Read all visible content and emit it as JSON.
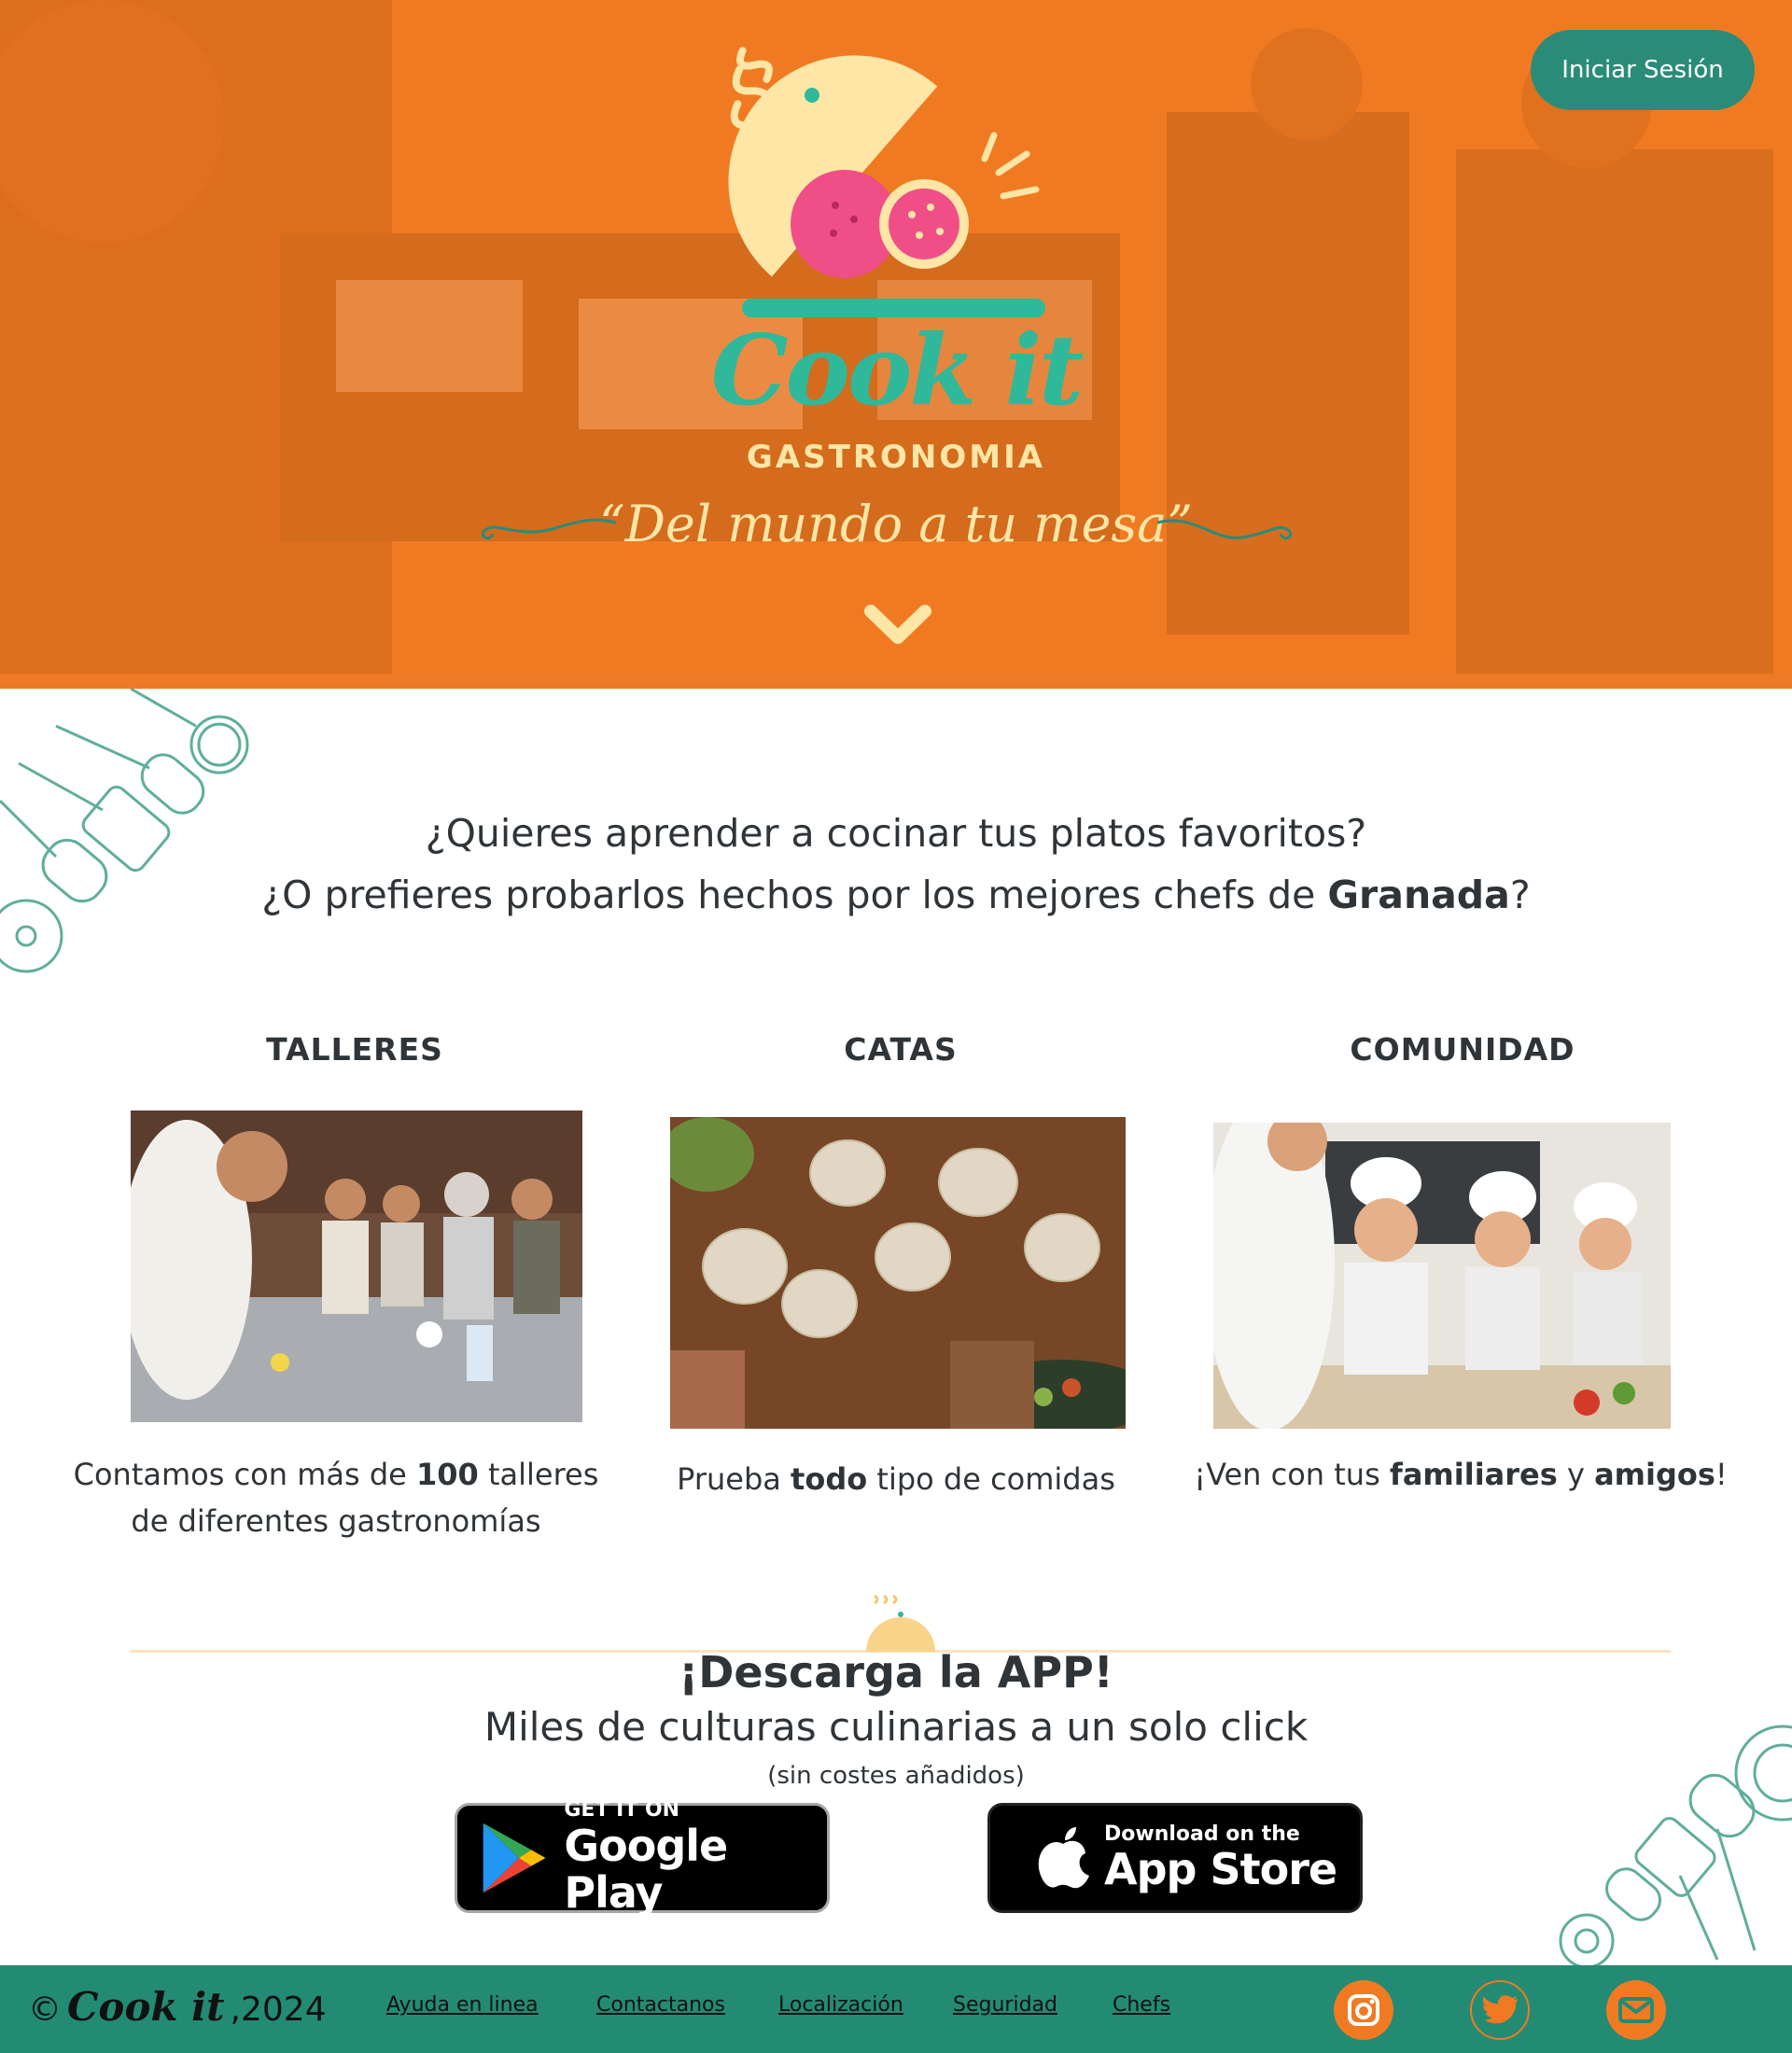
{
  "header": {
    "login_label": "Iniciar Sesión",
    "brand_name": "Cook it",
    "brand_subtitle": "GASTRONOMIA",
    "slogan": "“Del mundo a tu mesa”",
    "scroll_icon": "chevron-down-icon"
  },
  "intro": {
    "line1": "¿Quieres aprender a cocinar tus platos favoritos?",
    "line2_prefix": "¿O prefieres probarlos hechos por los mejores chefs de ",
    "line2_bold": "Granada",
    "line2_suffix": "?"
  },
  "features": [
    {
      "title": "TALLERES",
      "desc_a": "Contamos con más de ",
      "desc_b": "100",
      "desc_c": " talleres",
      "desc_d": "de diferentes gastronomías"
    },
    {
      "title": "CATAS",
      "desc_a": "Prueba ",
      "desc_b": "todo",
      "desc_c": " tipo de comidas"
    },
    {
      "title": "COMUNIDAD",
      "desc_a": "¡Ven con tus ",
      "desc_b": "familiares",
      "desc_c": " y ",
      "desc_d": "amigos",
      "desc_e": "!"
    }
  ],
  "app": {
    "title": "¡Descarga la APP!",
    "subtitle": "Miles de culturas culinarias a un solo click",
    "note": "(sin costes añadidos)",
    "google_small": "GET IT ON",
    "google_big": "Google Play",
    "apple_small": "Download on the",
    "apple_big": "App Store"
  },
  "footer": {
    "copyright_symbol": "©",
    "brand": "Cook it",
    "year": ",2024",
    "links": [
      "Ayuda en linea",
      "Contactanos",
      "Localización",
      "Seguridad",
      "Chefs"
    ],
    "social_icons": [
      "instagram-icon",
      "twitter-icon",
      "mail-icon"
    ]
  },
  "colors": {
    "hero_orange": "#f07a22",
    "teal": "#238b73",
    "cream": "#fde6a6",
    "brand_green": "#2fb89a",
    "pink": "#ef4f86"
  }
}
